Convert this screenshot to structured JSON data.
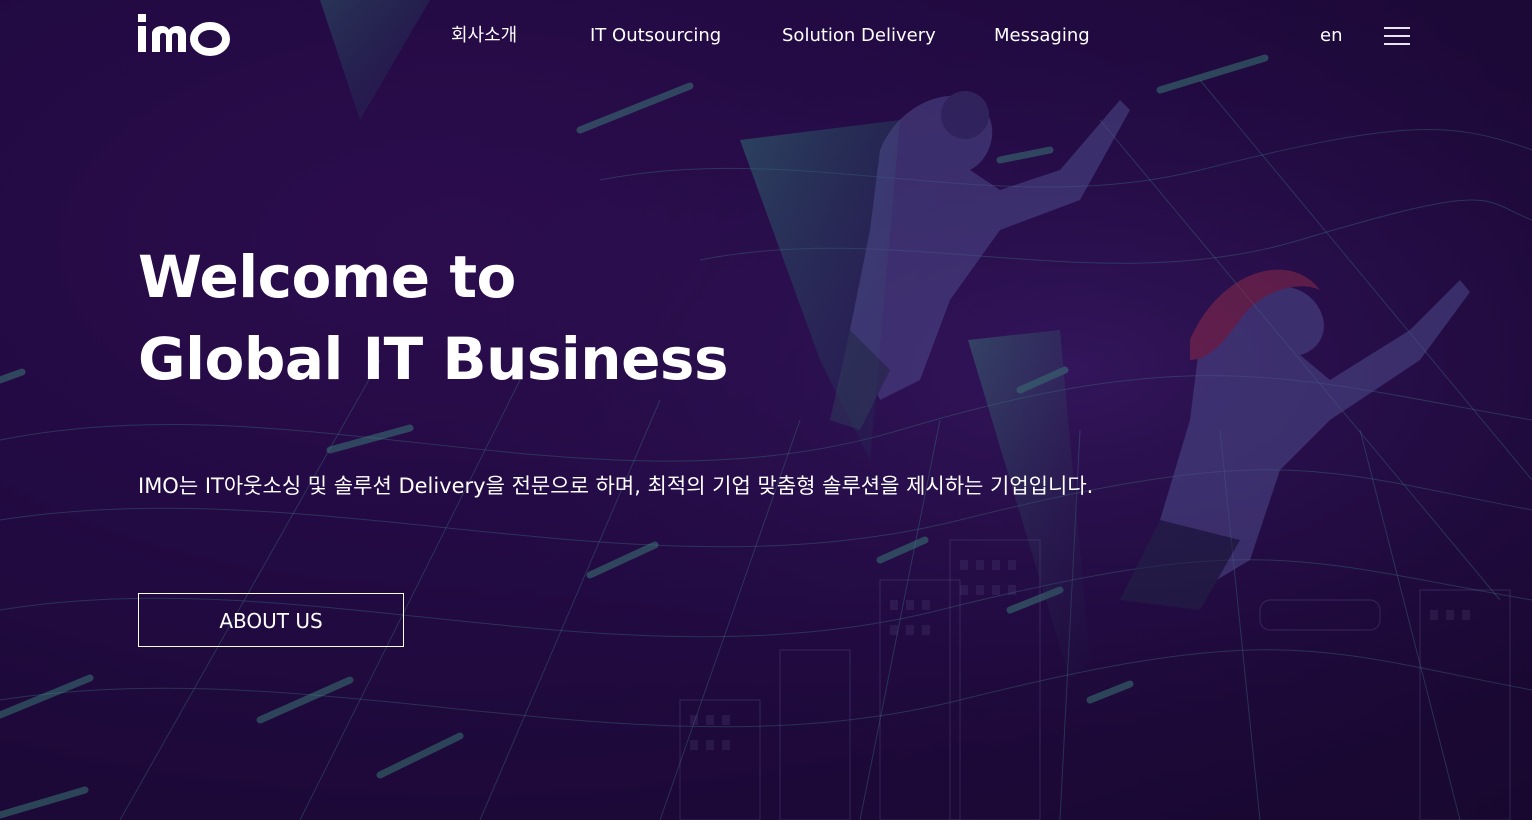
{
  "brand": {
    "logo_text": "imo",
    "accent_color": "#ffffff",
    "background_color": "#220a42"
  },
  "nav": {
    "items": [
      {
        "label": "회사소개"
      },
      {
        "label": "IT Outsourcing"
      },
      {
        "label": "Solution Delivery"
      },
      {
        "label": "Messaging"
      }
    ],
    "language_label": "en",
    "menu_icon": "hamburger-menu-icon"
  },
  "hero": {
    "title_line1": "Welcome to",
    "title_line2": "Global IT Business",
    "description": "IMO는 IT아웃소싱 및 솔루션 Delivery을 전문으로 하며, 최적의 기업 맞춤형 솔루션을 제시하는 기업입니다.",
    "button_label": "ABOUT US"
  }
}
